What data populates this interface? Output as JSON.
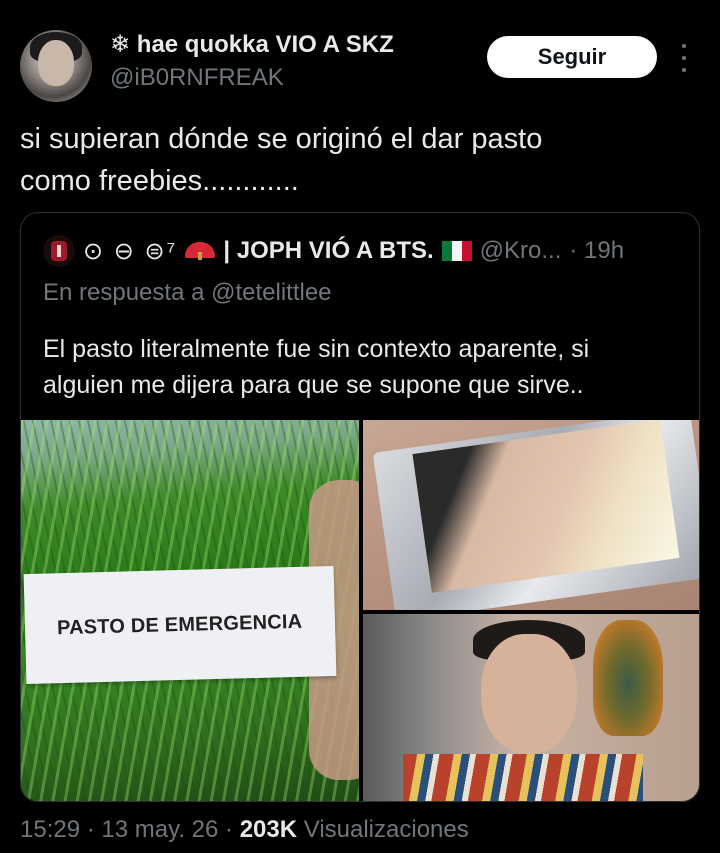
{
  "author": {
    "display_name": "❄ hae quokka VIO A SKZ",
    "handle": "@iB0RNFREAK",
    "follow_label": "Seguir"
  },
  "tweet": {
    "text": "si supieran dónde se originó el dar pasto\ncomo freebies............"
  },
  "quoted_tweet": {
    "symbols": "⊙ ⊖ ⊜⁷",
    "display_name": "| JOPH VIÓ A BTS.",
    "handle": "@Kro...",
    "time": "· 19h",
    "reply_prefix": "En respuesta a",
    "reply_to": "@tetelittlee",
    "text": "El pasto literalmente fue sin contexto aparente, si\nalguien me dijera para que se supone que sirve..",
    "images": [
      {
        "label_text": "PASTO DE EMERGENCIA"
      }
    ]
  },
  "footer": {
    "time": "15:29",
    "date": "13 may. 26",
    "views_count": "203K",
    "views_label": "Visualizaciones"
  },
  "colors": {
    "background": "#000000",
    "text_primary": "#e7e9ea",
    "text_secondary": "#71767b",
    "border": "#2f3336",
    "follow_bg": "#ffffff"
  }
}
